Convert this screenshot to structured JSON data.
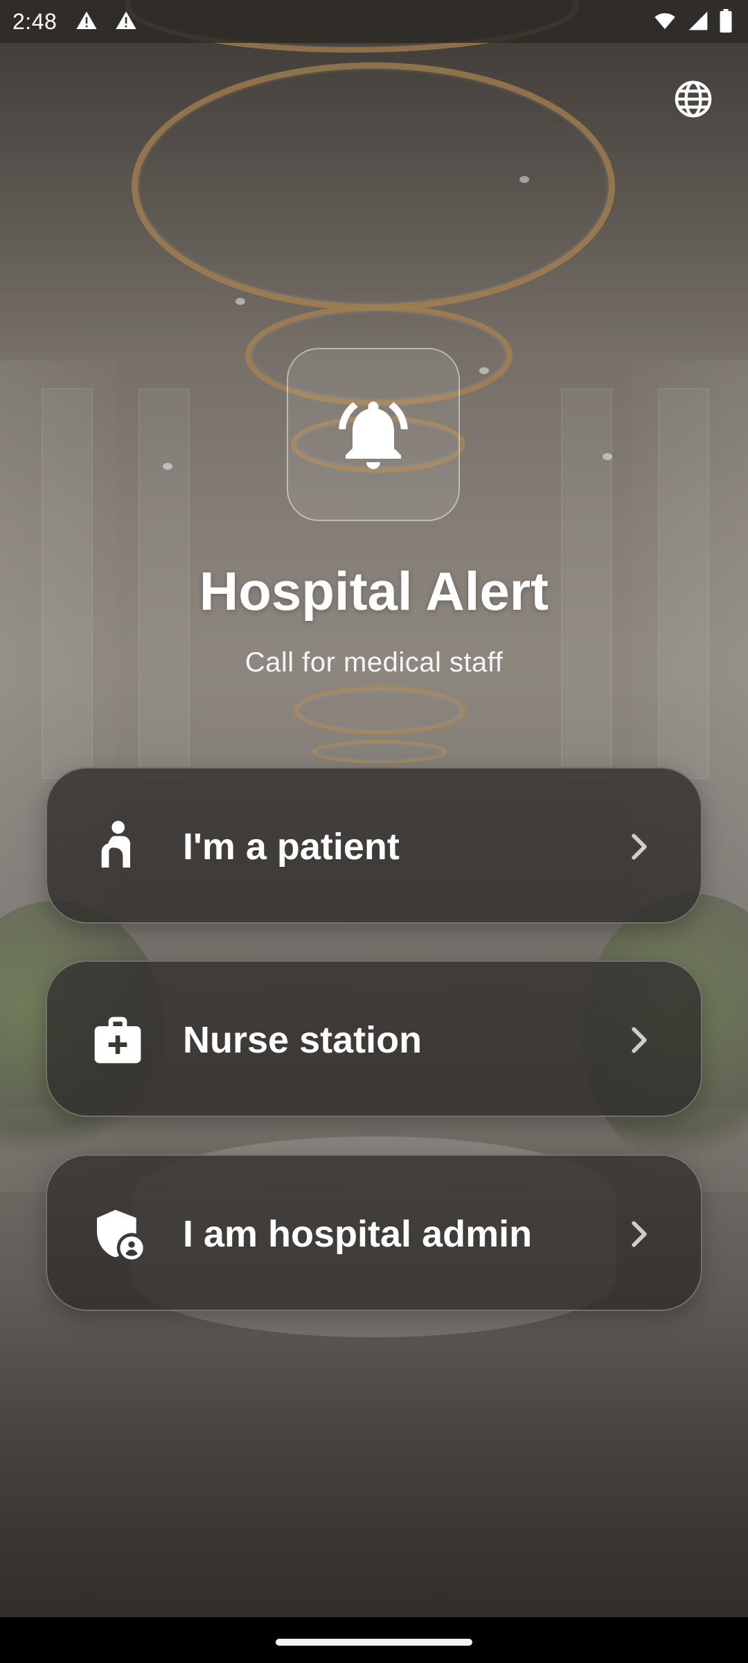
{
  "status_bar": {
    "time": "2:48",
    "icons": [
      "warning-icon",
      "warning-icon",
      "wifi-icon",
      "signal-icon",
      "battery-icon"
    ]
  },
  "header": {
    "language_icon": "globe-icon",
    "logo_icon": "bell-alert-icon",
    "title": "Hospital Alert",
    "subtitle": "Call for medical staff"
  },
  "roles": [
    {
      "label": "I'm a patient",
      "icon": "patient-icon"
    },
    {
      "label": "Nurse station",
      "icon": "medical-kit-icon"
    },
    {
      "label": "I am hospital admin",
      "icon": "admin-shield-icon"
    }
  ],
  "colors": {
    "text": "#ffffff",
    "card_background": "#363330",
    "card_border": "#8a8580",
    "ring_gold": "#be965f"
  }
}
